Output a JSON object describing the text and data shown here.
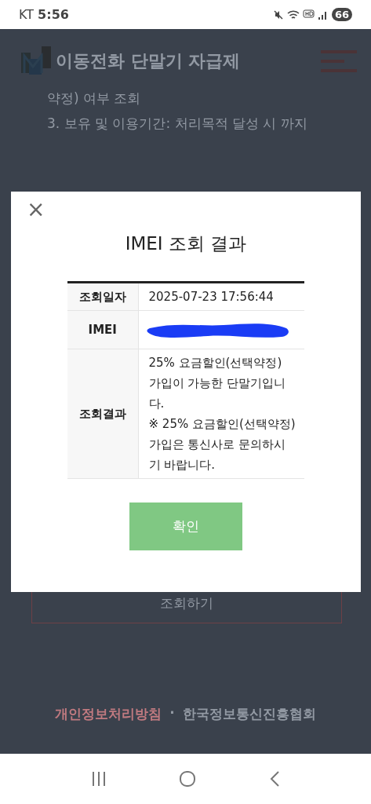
{
  "status_bar": {
    "carrier": "KT",
    "time": "5:56",
    "battery": "66"
  },
  "header": {
    "title": "이동전화 단말기 자급제"
  },
  "notice_lines": [
    "약정) 여부 조회",
    "3. 보유 및 이용기간: 처리목적 달성 시 까지"
  ],
  "search_button": {
    "label": "조회하기"
  },
  "footer_links": [
    {
      "label": "개인정보처리방침",
      "kind": "accent"
    },
    {
      "label": "·",
      "kind": "separator"
    },
    {
      "label": "한국정보통신진흥협회",
      "kind": "plain"
    }
  ],
  "dialog": {
    "title": "IMEI 조회 결과",
    "close": "×",
    "rows": [
      {
        "label": "조회일자",
        "value": "2025-07-23 17:56:44",
        "kind": "text"
      },
      {
        "label": "IMEI",
        "kind": "redacted"
      },
      {
        "label": "조회결과",
        "value": "25% 요금할인(선택약정) 가입이 가능한 단말기입니다.",
        "note": "※ 25% 요금할인(선택약정) 가입은 통신사로 문의하시기 바랍니다.",
        "kind": "text"
      }
    ],
    "confirm": "확인"
  }
}
